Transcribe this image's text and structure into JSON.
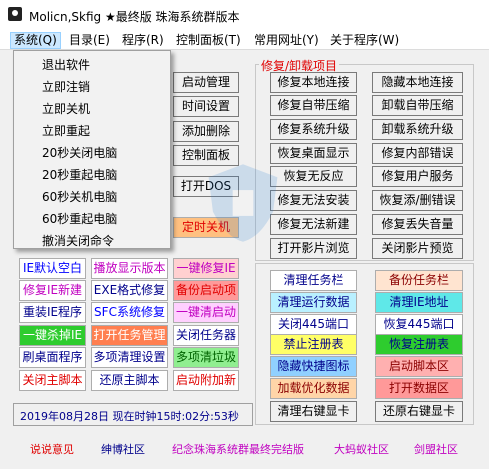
{
  "window": {
    "title": "Molicn,Skfig ★最终版 珠海系统群版本",
    "icon": "app-icon"
  },
  "menubar": [
    {
      "label": "系统(Q)",
      "active": true
    },
    {
      "label": "目录(E)"
    },
    {
      "label": "程序(R)"
    },
    {
      "label": "控制面板(T)"
    },
    {
      "label": "常用网址(Y)"
    },
    {
      "label": "关于程序(W)"
    }
  ],
  "system_menu": [
    "退出软件",
    "立即注销",
    "立即关机",
    "立即重起",
    "20秒关闭电脑",
    "20秒重起电脑",
    "60秒关机电脑",
    "60秒重起电脑",
    "撤消关闭命令"
  ],
  "middle_buttons": [
    "启动管理",
    "时间设置",
    "添加删除",
    "控制面板",
    "打开DOS",
    "定时关机"
  ],
  "left_grid": [
    [
      "IE默认空白",
      "播放显示版本",
      "一键修复IE"
    ],
    [
      "修复IE新建",
      "EXE格式修复",
      "备份启动项"
    ],
    [
      "重装IE程序",
      "SFC系统修复",
      "一键清启动"
    ],
    [
      "一键杀掉IE",
      "打开任务管理",
      "关闭任务器"
    ],
    [
      "刷桌面程序",
      "多项清理设置",
      "多项清垃圾"
    ],
    [
      "关闭主脚本",
      "还原主脚本",
      "启动附加新"
    ]
  ],
  "repair_group": {
    "label": "修复/卸载项目",
    "rows": [
      [
        "修复本地连接",
        "隐藏本地连接"
      ],
      [
        "修复自带压缩",
        "卸载自带压缩"
      ],
      [
        "修复系统升级",
        "卸载系统升级"
      ],
      [
        "恢复桌面显示",
        "修复内部错误"
      ],
      [
        "恢复无反应",
        "修复用户服务"
      ],
      [
        "修复无法安装",
        "恢复添/删错误"
      ],
      [
        "修复无法新建",
        "修复丢失音量"
      ],
      [
        "打开影片浏览",
        "关闭影片预览"
      ]
    ]
  },
  "right_grid": [
    [
      "清理任务栏",
      "备份任务栏"
    ],
    [
      "清理运行数据",
      "清理IE地址"
    ],
    [
      "关闭445端口",
      "恢复445端口"
    ],
    [
      "禁止注册表",
      "恢复注册表"
    ],
    [
      "隐藏快捷图标",
      "启动脚本区"
    ],
    [
      "加载优化数据",
      "打开数据区"
    ],
    [
      "清理右键显卡",
      "还原右键显卡"
    ]
  ],
  "status": {
    "text": "2019年08月28日 现在时钟15时:02分:53秒"
  },
  "footer": [
    "说说意见",
    "绅博社区",
    "纪念珠海系统群最终完结版",
    "大蚂蚁社区",
    "剑盟社区"
  ],
  "colors": {
    "red": "#e00000",
    "blue": "#0000ff",
    "purple": "#c000c0",
    "pink_bg": "#ffd0d0",
    "green_bg": "#2ecc2e",
    "yellow_bg": "#ffff66",
    "peach_bg": "#ffd5a8",
    "cyan_bg": "#5fe8e8",
    "lightgreen_bg": "#90ee90"
  }
}
